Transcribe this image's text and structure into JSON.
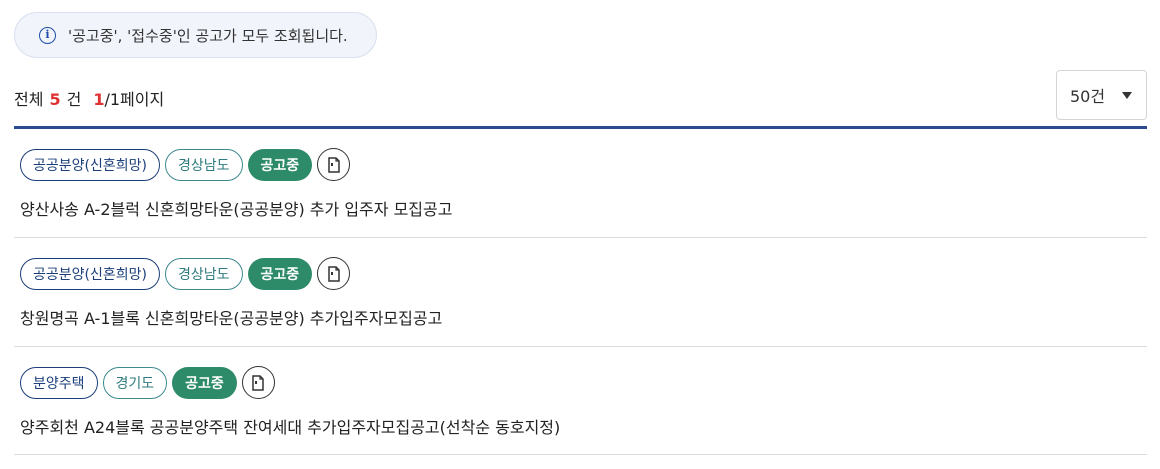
{
  "notice": {
    "icon": "info-icon",
    "text": "'공고중', '접수중'인 공고가 모두 조회됩니다."
  },
  "summary": {
    "total_label": "전체",
    "total_count": "5",
    "total_unit": "건",
    "current_page": "1",
    "page_rest": "/1페이지"
  },
  "page_size": {
    "selected": "50건"
  },
  "colors": {
    "accent": "#2a4b8d",
    "status_green": "#2e8b6a",
    "count_red": "#e03131"
  },
  "items": [
    {
      "type_tag": "공공분양(신혼희망)",
      "region_tag": "경상남도",
      "status_tag": "공고중",
      "doc_icon": "document-icon",
      "title": "양산사송 A-2블럭 신혼희망타운(공공분양) 추가 입주자 모집공고"
    },
    {
      "type_tag": "공공분양(신혼희망)",
      "region_tag": "경상남도",
      "status_tag": "공고중",
      "doc_icon": "document-icon",
      "title": "창원명곡 A-1블록 신혼희망타운(공공분양) 추가입주자모집공고"
    },
    {
      "type_tag": "분양주택",
      "region_tag": "경기도",
      "status_tag": "공고중",
      "doc_icon": "document-icon",
      "title": "양주회천 A24블록 공공분양주택 잔여세대 추가입주자모집공고(선착순 동호지정)"
    }
  ]
}
